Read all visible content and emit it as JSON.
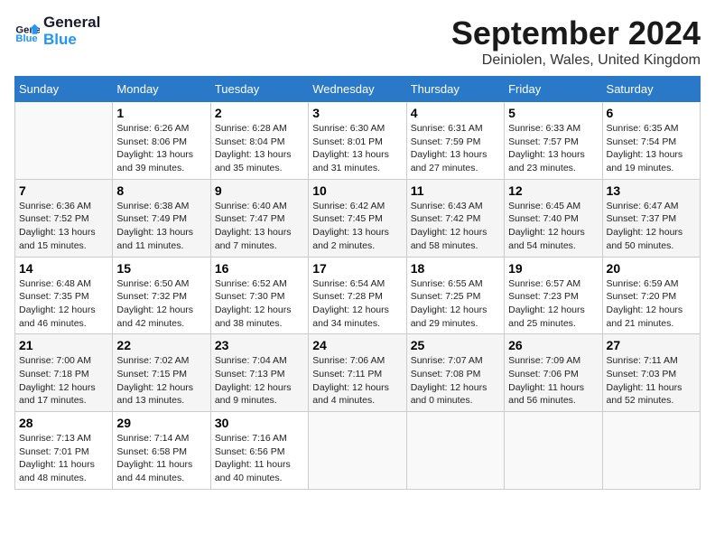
{
  "logo": {
    "line1": "General",
    "line2": "Blue"
  },
  "title": "September 2024",
  "location": "Deiniolen, Wales, United Kingdom",
  "weekdays": [
    "Sunday",
    "Monday",
    "Tuesday",
    "Wednesday",
    "Thursday",
    "Friday",
    "Saturday"
  ],
  "days": [
    {
      "date": "",
      "content": ""
    },
    {
      "date": "1",
      "content": "Sunrise: 6:26 AM\nSunset: 8:06 PM\nDaylight: 13 hours\nand 39 minutes."
    },
    {
      "date": "2",
      "content": "Sunrise: 6:28 AM\nSunset: 8:04 PM\nDaylight: 13 hours\nand 35 minutes."
    },
    {
      "date": "3",
      "content": "Sunrise: 6:30 AM\nSunset: 8:01 PM\nDaylight: 13 hours\nand 31 minutes."
    },
    {
      "date": "4",
      "content": "Sunrise: 6:31 AM\nSunset: 7:59 PM\nDaylight: 13 hours\nand 27 minutes."
    },
    {
      "date": "5",
      "content": "Sunrise: 6:33 AM\nSunset: 7:57 PM\nDaylight: 13 hours\nand 23 minutes."
    },
    {
      "date": "6",
      "content": "Sunrise: 6:35 AM\nSunset: 7:54 PM\nDaylight: 13 hours\nand 19 minutes."
    },
    {
      "date": "7",
      "content": "Sunrise: 6:36 AM\nSunset: 7:52 PM\nDaylight: 13 hours\nand 15 minutes."
    },
    {
      "date": "8",
      "content": "Sunrise: 6:38 AM\nSunset: 7:49 PM\nDaylight: 13 hours\nand 11 minutes."
    },
    {
      "date": "9",
      "content": "Sunrise: 6:40 AM\nSunset: 7:47 PM\nDaylight: 13 hours\nand 7 minutes."
    },
    {
      "date": "10",
      "content": "Sunrise: 6:42 AM\nSunset: 7:45 PM\nDaylight: 13 hours\nand 2 minutes."
    },
    {
      "date": "11",
      "content": "Sunrise: 6:43 AM\nSunset: 7:42 PM\nDaylight: 12 hours\nand 58 minutes."
    },
    {
      "date": "12",
      "content": "Sunrise: 6:45 AM\nSunset: 7:40 PM\nDaylight: 12 hours\nand 54 minutes."
    },
    {
      "date": "13",
      "content": "Sunrise: 6:47 AM\nSunset: 7:37 PM\nDaylight: 12 hours\nand 50 minutes."
    },
    {
      "date": "14",
      "content": "Sunrise: 6:48 AM\nSunset: 7:35 PM\nDaylight: 12 hours\nand 46 minutes."
    },
    {
      "date": "15",
      "content": "Sunrise: 6:50 AM\nSunset: 7:32 PM\nDaylight: 12 hours\nand 42 minutes."
    },
    {
      "date": "16",
      "content": "Sunrise: 6:52 AM\nSunset: 7:30 PM\nDaylight: 12 hours\nand 38 minutes."
    },
    {
      "date": "17",
      "content": "Sunrise: 6:54 AM\nSunset: 7:28 PM\nDaylight: 12 hours\nand 34 minutes."
    },
    {
      "date": "18",
      "content": "Sunrise: 6:55 AM\nSunset: 7:25 PM\nDaylight: 12 hours\nand 29 minutes."
    },
    {
      "date": "19",
      "content": "Sunrise: 6:57 AM\nSunset: 7:23 PM\nDaylight: 12 hours\nand 25 minutes."
    },
    {
      "date": "20",
      "content": "Sunrise: 6:59 AM\nSunset: 7:20 PM\nDaylight: 12 hours\nand 21 minutes."
    },
    {
      "date": "21",
      "content": "Sunrise: 7:00 AM\nSunset: 7:18 PM\nDaylight: 12 hours\nand 17 minutes."
    },
    {
      "date": "22",
      "content": "Sunrise: 7:02 AM\nSunset: 7:15 PM\nDaylight: 12 hours\nand 13 minutes."
    },
    {
      "date": "23",
      "content": "Sunrise: 7:04 AM\nSunset: 7:13 PM\nDaylight: 12 hours\nand 9 minutes."
    },
    {
      "date": "24",
      "content": "Sunrise: 7:06 AM\nSunset: 7:11 PM\nDaylight: 12 hours\nand 4 minutes."
    },
    {
      "date": "25",
      "content": "Sunrise: 7:07 AM\nSunset: 7:08 PM\nDaylight: 12 hours\nand 0 minutes."
    },
    {
      "date": "26",
      "content": "Sunrise: 7:09 AM\nSunset: 7:06 PM\nDaylight: 11 hours\nand 56 minutes."
    },
    {
      "date": "27",
      "content": "Sunrise: 7:11 AM\nSunset: 7:03 PM\nDaylight: 11 hours\nand 52 minutes."
    },
    {
      "date": "28",
      "content": "Sunrise: 7:13 AM\nSunset: 7:01 PM\nDaylight: 11 hours\nand 48 minutes."
    },
    {
      "date": "29",
      "content": "Sunrise: 7:14 AM\nSunset: 6:58 PM\nDaylight: 11 hours\nand 44 minutes."
    },
    {
      "date": "30",
      "content": "Sunrise: 7:16 AM\nSunset: 6:56 PM\nDaylight: 11 hours\nand 40 minutes."
    },
    {
      "date": "",
      "content": ""
    },
    {
      "date": "",
      "content": ""
    },
    {
      "date": "",
      "content": ""
    },
    {
      "date": "",
      "content": ""
    },
    {
      "date": "",
      "content": ""
    }
  ]
}
